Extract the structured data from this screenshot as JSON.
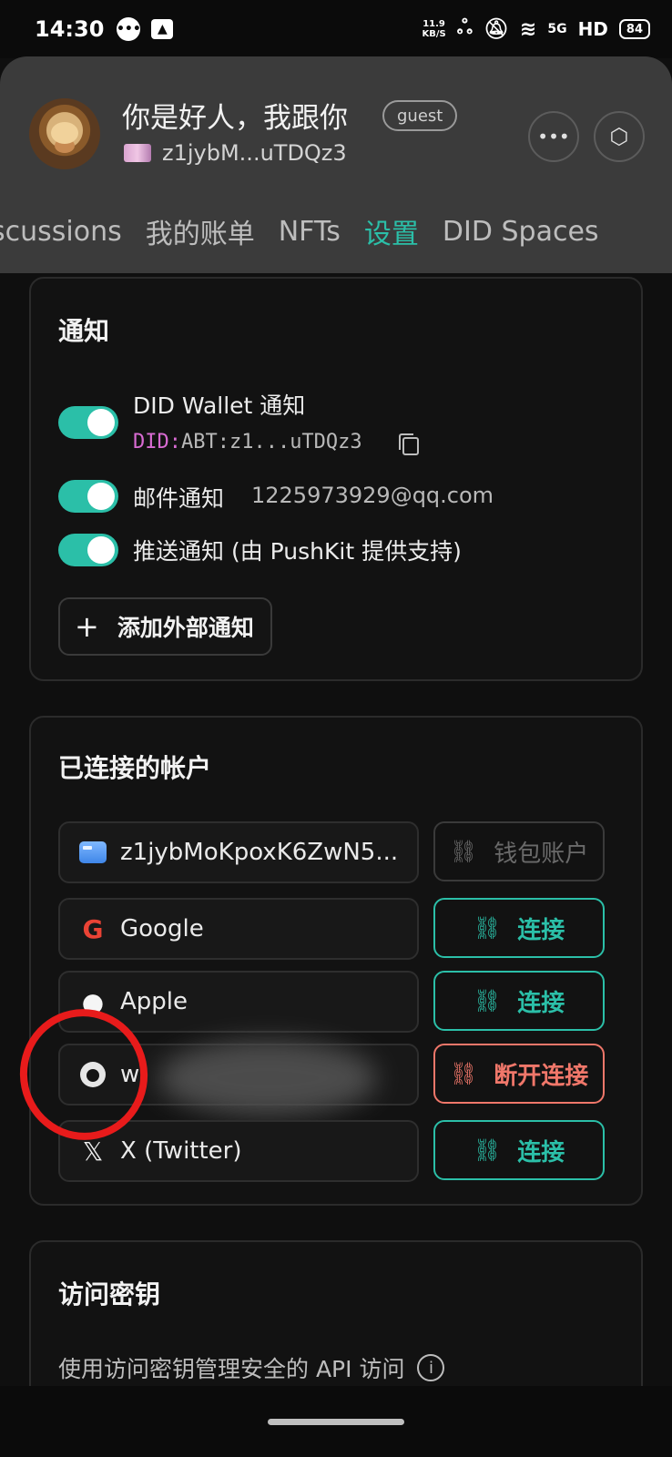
{
  "status_bar": {
    "time": "14:30",
    "net_speed": "11.9",
    "net_unit": "KB/S",
    "signal": "5G",
    "hd": "HD",
    "battery": "84"
  },
  "profile": {
    "name": "你是好人，我跟你",
    "badge": "guest",
    "did_short": "z1jybM...uTDQz3"
  },
  "tabs": [
    "scussions",
    "我的账单",
    "NFTs",
    "设置",
    "DID Spaces"
  ],
  "active_tab": "设置",
  "notifications": {
    "title": "通知",
    "items": [
      {
        "label": "DID Wallet 通知",
        "enabled": true
      },
      {
        "label": "邮件通知",
        "detail": "1225973929@qq.com",
        "enabled": true
      },
      {
        "label": "推送通知 (由 PushKit 提供支持)",
        "enabled": true
      }
    ],
    "did_prefix": "DID:",
    "did_value": "ABT:z1...uTDQz3",
    "add_button": "添加外部通知"
  },
  "connected_accounts": {
    "title": "已连接的帐户",
    "accounts": [
      {
        "name": "z1jybMoKpoxK6ZwN5...",
        "icon": "wallet-icon",
        "action": "钱包账户",
        "state": "disabled"
      },
      {
        "name": "Google",
        "icon": "google-icon",
        "action": "连接",
        "state": "connect"
      },
      {
        "name": "Apple",
        "icon": "apple-icon",
        "action": "连接",
        "state": "connect"
      },
      {
        "name": "w",
        "icon": "github-icon",
        "action": "断开连接",
        "state": "disconnect"
      },
      {
        "name": "X (Twitter)",
        "icon": "x-icon",
        "action": "连接",
        "state": "connect"
      }
    ]
  },
  "access_keys": {
    "title": "访问密钥",
    "description": "使用访问密钥管理安全的 API 访问"
  },
  "colors": {
    "accent": "#2bbfa8",
    "danger": "#f0776a",
    "did_prefix": "#d86bd2",
    "annotation": "#e81b1b"
  }
}
